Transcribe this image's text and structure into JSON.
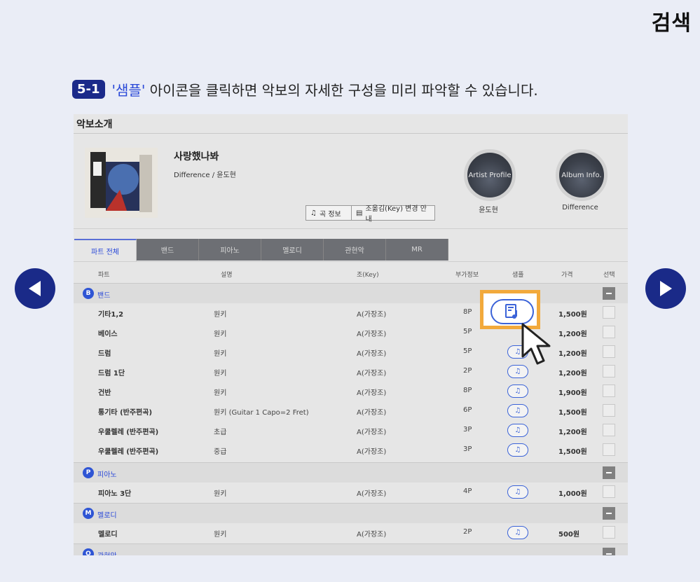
{
  "corner_title": "검색",
  "caption": {
    "step": "5-1",
    "quoted": "'샘플'",
    "text": " 아이콘을 클릭하면 악보의 자세한 구성을 미리 파악할 수 있습니다."
  },
  "panel": {
    "title": "악보소개",
    "song": {
      "title": "사랑했나봐",
      "subtitle": "Difference / 윤도현"
    },
    "buttons": {
      "song_info": "곡 정보",
      "key_change": "조옮김(Key) 변경 안내"
    },
    "artist_circle": {
      "label": "Artist Profile",
      "name": "윤도현"
    },
    "album_circle": {
      "label": "Album Info.",
      "name": "Difference"
    },
    "tabs": [
      {
        "label": "파트 전체",
        "active": true
      },
      {
        "label": "밴드"
      },
      {
        "label": "피아노"
      },
      {
        "label": "멜로디"
      },
      {
        "label": "관현악"
      },
      {
        "label": "MR"
      }
    ],
    "columns": {
      "part": "파트",
      "desc": "설명",
      "key": "조(Key)",
      "extra": "부가정보",
      "sample": "샘플",
      "price": "가격",
      "select": "선택"
    },
    "groups": {
      "band": {
        "badge": "B",
        "label": "밴드"
      },
      "piano": {
        "badge": "P",
        "label": "피아노"
      },
      "melody": {
        "badge": "M",
        "label": "멜로디"
      },
      "orch": {
        "badge": "O",
        "label": "관현악"
      }
    },
    "rows": [
      {
        "part": "기타1,2",
        "desc": "원키",
        "key": "A(가장조)",
        "pages": "8P",
        "price": "1,500원"
      },
      {
        "part": "베이스",
        "desc": "원키",
        "key": "A(가장조)",
        "pages": "5P",
        "price": "1,200원"
      },
      {
        "part": "드럼",
        "desc": "원키",
        "key": "A(가장조)",
        "pages": "5P",
        "price": "1,200원"
      },
      {
        "part": "드럼 1단",
        "desc": "원키",
        "key": "A(가장조)",
        "pages": "2P",
        "price": "1,200원"
      },
      {
        "part": "건반",
        "desc": "원키",
        "key": "A(가장조)",
        "pages": "8P",
        "price": "1,900원"
      },
      {
        "part": "통기타 (반주편곡)",
        "desc": "원키 (Guitar 1 Capo=2 Fret)",
        "key": "A(가장조)",
        "pages": "6P",
        "price": "1,500원"
      },
      {
        "part": "우쿨렐레 (반주편곡)",
        "desc": "초급",
        "key": "A(가장조)",
        "pages": "3P",
        "price": "1,200원"
      },
      {
        "part": "우쿨렐레 (반주편곡)",
        "desc": "중급",
        "key": "A(가장조)",
        "pages": "3P",
        "price": "1,500원"
      },
      {
        "part": "피아노 3단",
        "desc": "원키",
        "key": "A(가장조)",
        "pages": "4P",
        "price": "1,000원"
      },
      {
        "part": "멜로디",
        "desc": "원키",
        "key": "A(가장조)",
        "pages": "2P",
        "price": "500원"
      }
    ]
  }
}
